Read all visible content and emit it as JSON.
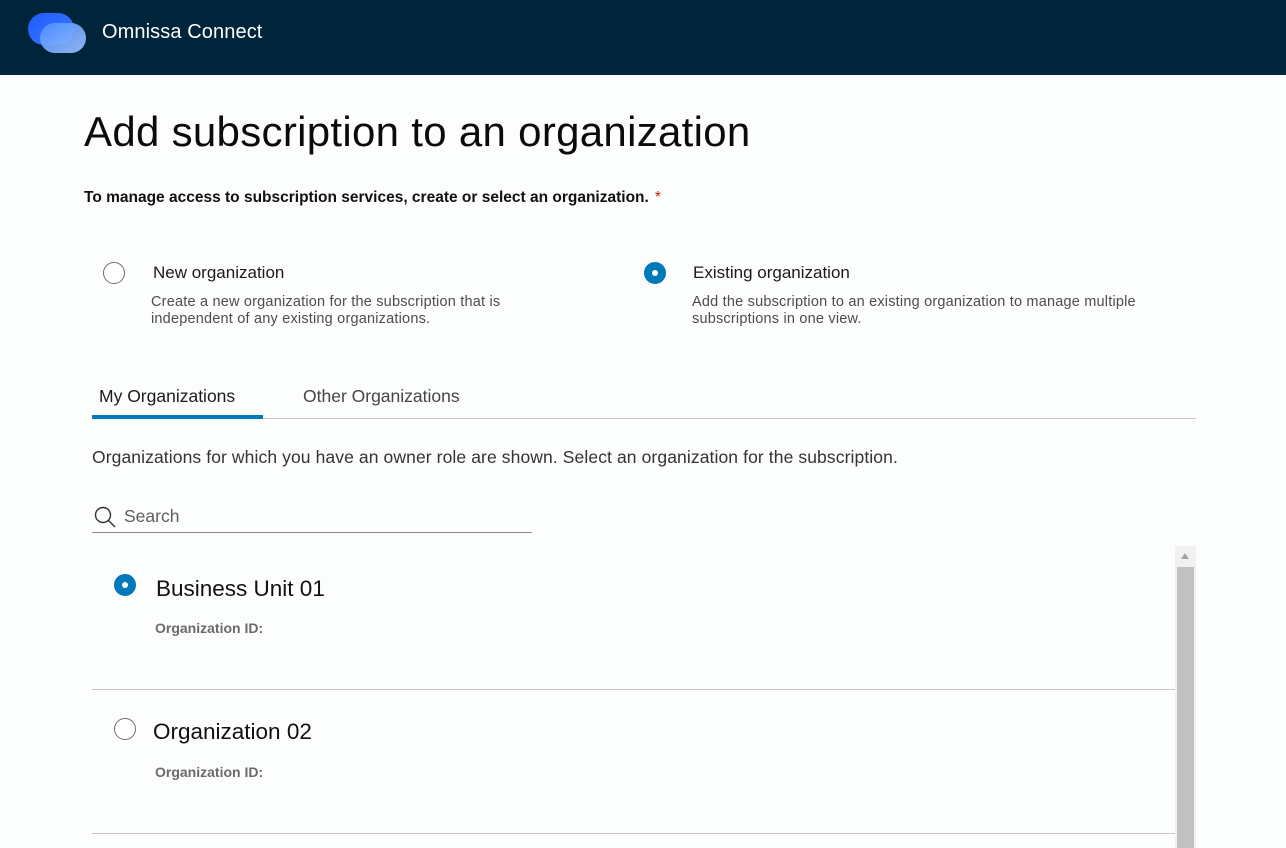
{
  "app": {
    "title": "Omnissa Connect",
    "logo_icon": "omnissa-logo-icon",
    "colors": {
      "header_bg": "#00243a",
      "accent": "#0079b8",
      "required": "#c92100"
    }
  },
  "page": {
    "title": "Add subscription to an organization",
    "instruction": "To manage access to subscription services, create or select an organization.",
    "required_marker": "*"
  },
  "org_type_options": [
    {
      "title": "New organization",
      "description": "Create a new organization for the subscription that is independent of any existing organizations.",
      "selected": false
    },
    {
      "title": "Existing organization",
      "description": "Add the subscription to an existing organization to manage multiple subscriptions in one view.",
      "selected": true
    }
  ],
  "tabs": [
    {
      "label": "My Organizations",
      "active": true
    },
    {
      "label": "Other Organizations",
      "active": false
    }
  ],
  "tab_description": "Organizations for which you have an owner role are shown. Select an organization for the subscription.",
  "search": {
    "placeholder": "Search",
    "value": "",
    "icon": "search-icon"
  },
  "organizations": [
    {
      "name": "Business Unit 01",
      "id_label": "Organization ID:",
      "selected": true
    },
    {
      "name": "Organization 02",
      "id_label": "Organization ID:",
      "selected": false
    }
  ]
}
